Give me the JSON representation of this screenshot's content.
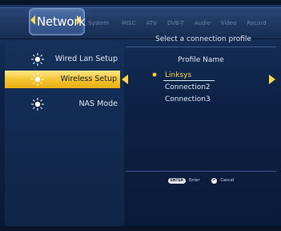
{
  "header": {
    "active_tab": "Network",
    "tabs": [
      "System",
      "MISC",
      "ATV",
      "DVB-T",
      "Audio",
      "Video",
      "Record"
    ]
  },
  "content": {
    "subtitle": "Select a connection profile"
  },
  "sidebar": {
    "items": [
      {
        "label": "Wired Lan Setup",
        "icon": "sun-icon",
        "selected": false
      },
      {
        "label": "Wireless Setup",
        "icon": "sun-icon",
        "selected": true
      },
      {
        "label": "NAS Mode",
        "icon": "sun-icon",
        "selected": false
      }
    ]
  },
  "profiles": {
    "header": "Profile Name",
    "items": [
      {
        "label": "Linksys",
        "selected": true
      },
      {
        "label": "Connection2",
        "selected": false
      },
      {
        "label": "Connection3",
        "selected": false
      }
    ]
  },
  "footer": {
    "enter_key": "ENTER",
    "enter_label": "Enter",
    "cancel_label": "Cancel"
  },
  "colors": {
    "accent": "#ffd84a",
    "highlight": "#f5c531",
    "background": "#0d2347",
    "text": "#dfe7f5"
  }
}
